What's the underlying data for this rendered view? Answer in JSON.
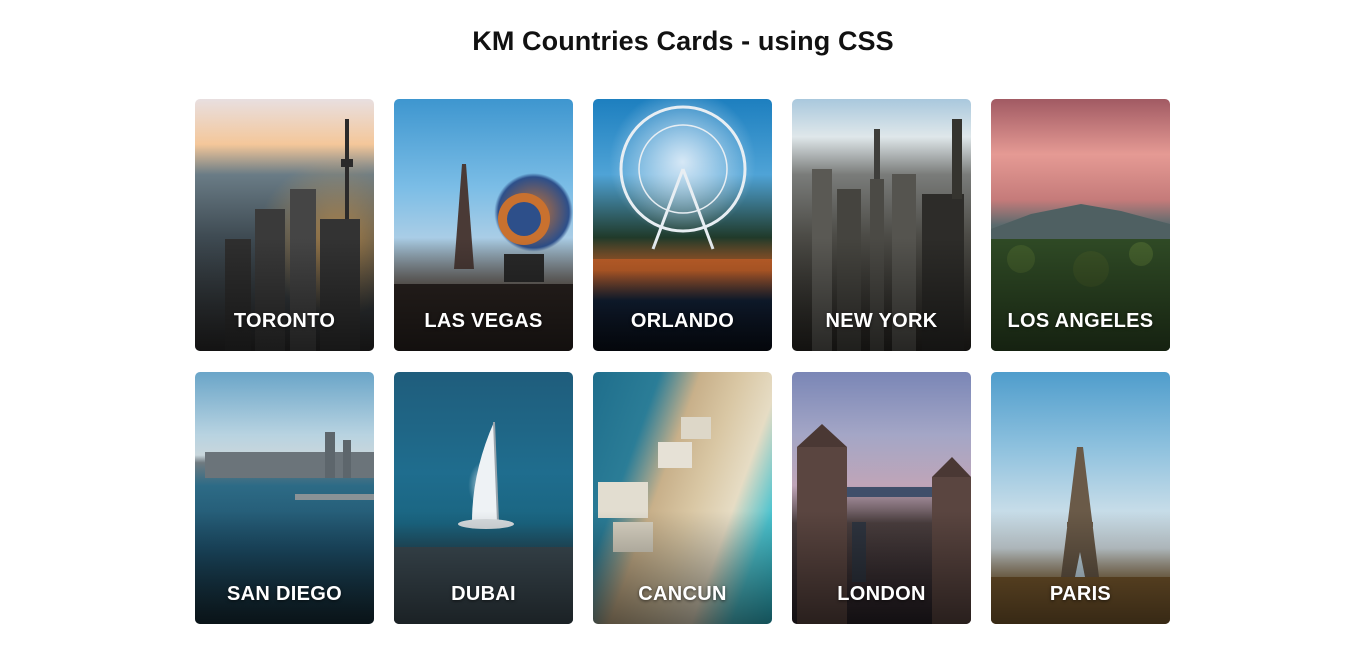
{
  "page": {
    "title": "KM Countries Cards - using CSS"
  },
  "cards": [
    {
      "label": "TORONTO"
    },
    {
      "label": "LAS VEGAS"
    },
    {
      "label": "ORLANDO"
    },
    {
      "label": "NEW YORK"
    },
    {
      "label": "LOS ANGELES"
    },
    {
      "label": "SAN DIEGO"
    },
    {
      "label": "DUBAI"
    },
    {
      "label": "CANCUN"
    },
    {
      "label": "LONDON"
    },
    {
      "label": "PARIS"
    }
  ]
}
